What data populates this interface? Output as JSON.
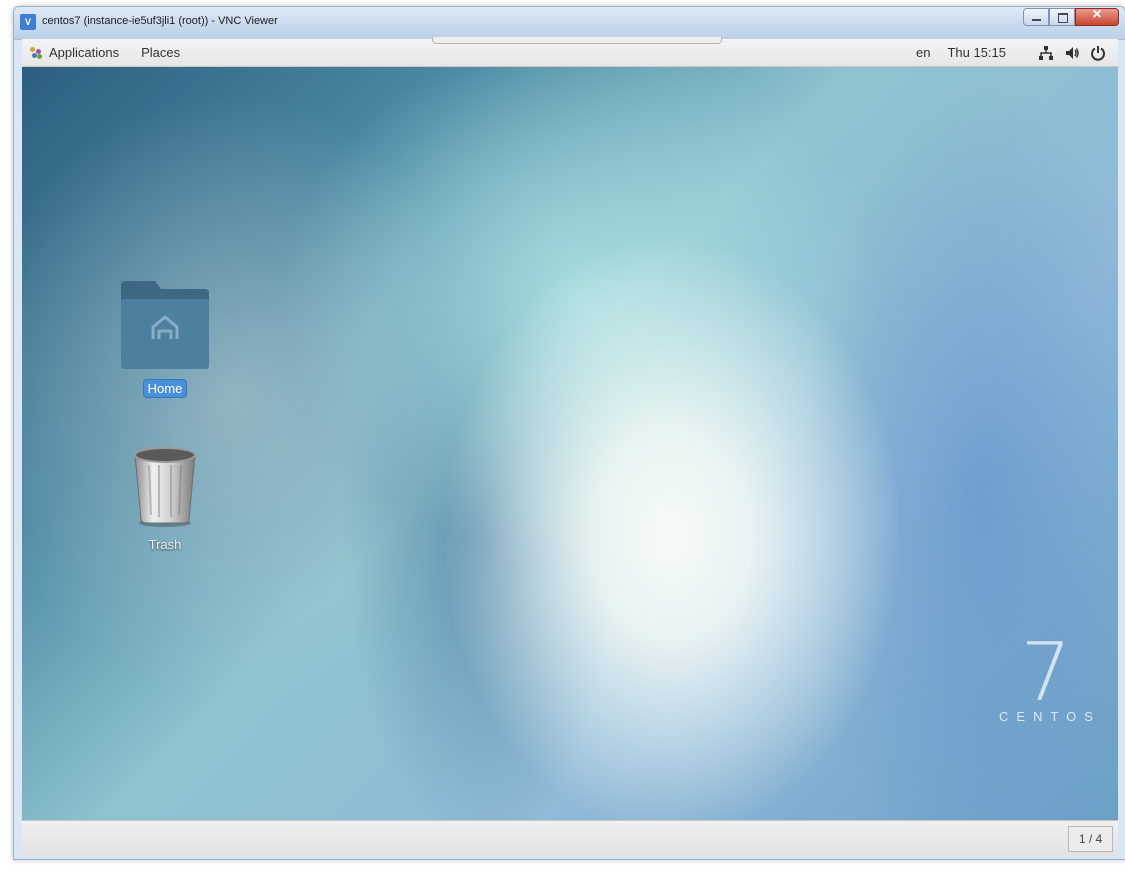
{
  "window": {
    "title": "centos7 (instance-ie5uf3jli1 (root)) - VNC Viewer",
    "app_icon": "vnc-viewer-icon",
    "controls": [
      "minimize",
      "maximize",
      "close"
    ]
  },
  "top_panel": {
    "applications_label": "Applications",
    "places_label": "Places",
    "language": "en",
    "clock": "Thu 15:15",
    "status_icons": [
      "network-icon",
      "volume-icon",
      "power-icon"
    ]
  },
  "desktop": {
    "icons": [
      {
        "label": "Home",
        "icon": "home-folder-icon",
        "selected": true
      },
      {
        "label": "Trash",
        "icon": "trash-icon",
        "selected": false
      }
    ],
    "logo": {
      "number": "7",
      "wordmark": "CENTOS"
    }
  },
  "bottom_panel": {
    "workspace": "1 / 4"
  },
  "colors": {
    "selection": "#4a90d9",
    "folder": "#4d7f9e",
    "close_button": "#c9452f"
  }
}
